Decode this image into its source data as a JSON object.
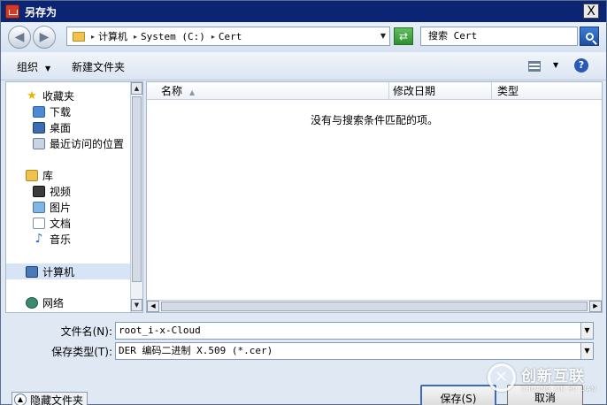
{
  "window": {
    "title": "另存为",
    "close_glyph": "X"
  },
  "address_bar": {
    "crumbs": [
      "计算机",
      "System (C:)",
      "Cert"
    ],
    "search_placeholder": "搜索 Cert"
  },
  "toolbar": {
    "organize_label": "组织",
    "new_folder_label": "新建文件夹"
  },
  "nav": {
    "favorites": "收藏夹",
    "downloads": "下载",
    "desktop": "桌面",
    "recent": "最近访问的位置",
    "libraries": "库",
    "videos": "视频",
    "pictures": "图片",
    "documents": "文档",
    "music": "音乐",
    "computer": "计算机",
    "network": "网络"
  },
  "file_list": {
    "columns": [
      "名称",
      "修改日期",
      "类型"
    ],
    "empty_message": "没有与搜索条件匹配的项。"
  },
  "form": {
    "filename_label": "文件名(N):",
    "filename_value": "root_i-x-Cloud",
    "filetype_label": "保存类型(T):",
    "filetype_value": "DER 编码二进制 X.509 (*.cer)"
  },
  "buttons": {
    "hide_folders": "隐藏文件夹",
    "save": "保存(S)",
    "cancel": "取消"
  },
  "watermark": {
    "brand_cn": "创新互联",
    "brand_en": "CHUANG XIN HU LIAN"
  }
}
